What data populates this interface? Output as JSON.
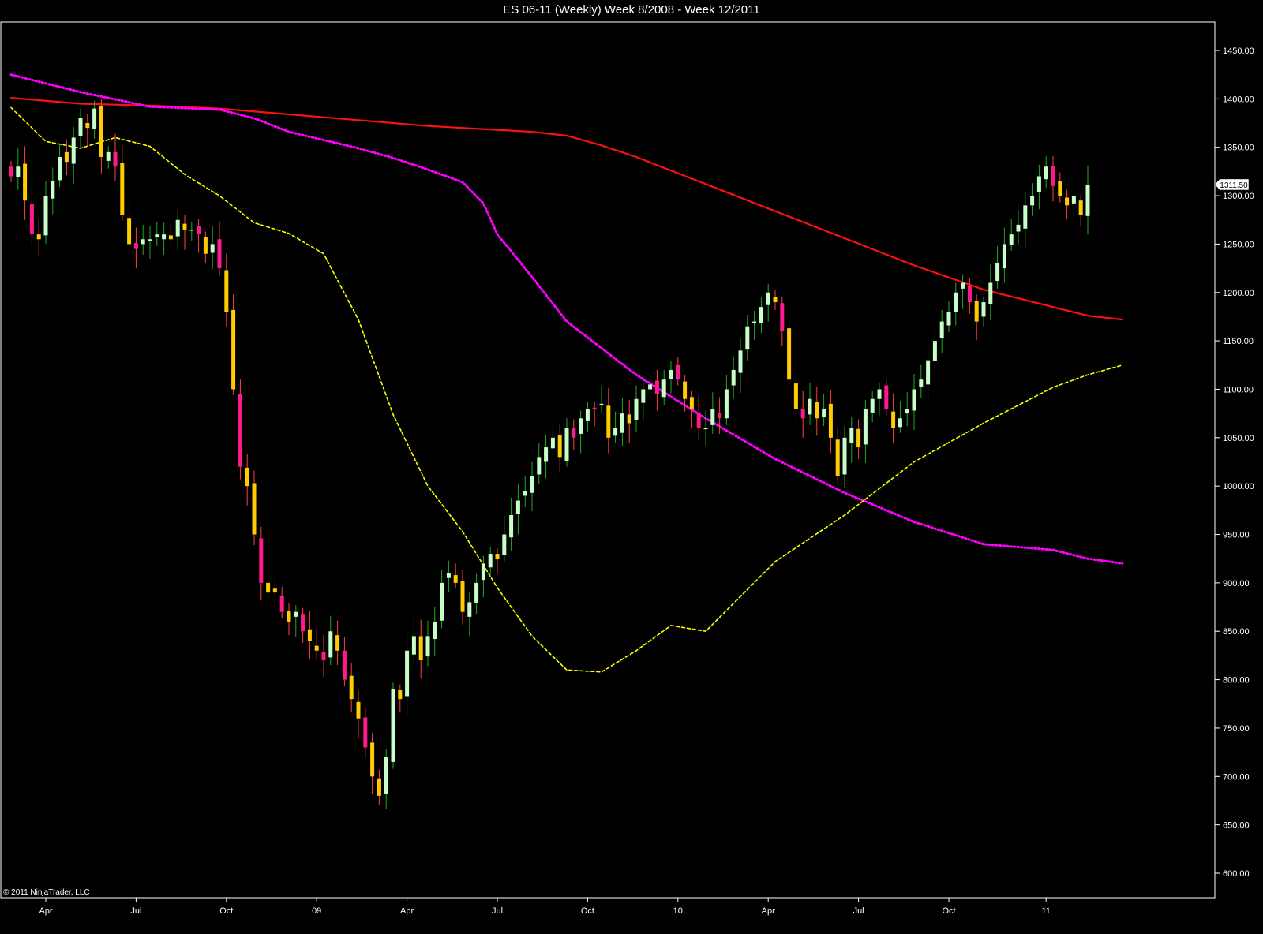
{
  "title": "ES 06-11 (Weekly)  Week 8/2008 - Week 12/2011",
  "copyright": "© 2011 NinjaTrader, LLC",
  "colors": {
    "background": "#000000",
    "up_candle": "#c8ffc8",
    "up_wick": "#22aa22",
    "down_candle": "#ffcc00",
    "down_pink": "#ff1a8c",
    "sma_fast": "#ffff00",
    "sma_mid": "#ff00ff",
    "sma_slow": "#ff1010",
    "axis": "#ffffff"
  },
  "chart_data": {
    "type": "candlestick",
    "title": "ES 06-11 (Weekly)  Week 8/2008 - Week 12/2011",
    "ylim": [
      590,
      1475
    ],
    "y_ticks": [
      "600.00",
      "650.00",
      "700.00",
      "750.00",
      "800.00",
      "850.00",
      "900.00",
      "950.00",
      "1000.00",
      "1050.00",
      "1100.00",
      "1150.00",
      "1200.00",
      "1250.00",
      "1300.00",
      "1350.00",
      "1400.00",
      "1450.00"
    ],
    "x_ticks": [
      {
        "label": "Apr",
        "week": 5
      },
      {
        "label": "Jul",
        "week": 18
      },
      {
        "label": "Oct",
        "week": 31
      },
      {
        "label": "09",
        "week": 44
      },
      {
        "label": "Apr",
        "week": 57
      },
      {
        "label": "Jul",
        "week": 70
      },
      {
        "label": "Oct",
        "week": 83
      },
      {
        "label": "10",
        "week": 96
      },
      {
        "label": "Apr",
        "week": 109
      },
      {
        "label": "Jul",
        "week": 122
      },
      {
        "label": "Oct",
        "week": 135
      },
      {
        "label": "11",
        "week": 149
      }
    ],
    "last_price": "1311.50",
    "grid": false,
    "closes": [
      1320,
      1330,
      1295,
      1260,
      1255,
      1300,
      1315,
      1340,
      1335,
      1360,
      1380,
      1370,
      1390,
      1340,
      1345,
      1330,
      1280,
      1250,
      1245,
      1255,
      1255,
      1260,
      1260,
      1255,
      1275,
      1265,
      1265,
      1260,
      1240,
      1250,
      1225,
      1180,
      1100,
      1020,
      1000,
      950,
      900,
      890,
      890,
      870,
      860,
      870,
      850,
      840,
      830,
      820,
      850,
      830,
      800,
      780,
      760,
      730,
      700,
      680,
      720,
      790,
      780,
      830,
      845,
      820,
      845,
      860,
      900,
      910,
      900,
      870,
      880,
      900,
      920,
      930,
      925,
      950,
      970,
      985,
      995,
      1010,
      1030,
      1040,
      1050,
      1030,
      1060,
      1050,
      1070,
      1080,
      1080,
      1085,
      1050,
      1060,
      1075,
      1065,
      1090,
      1100,
      1105,
      1095,
      1110,
      1120,
      1110,
      1090,
      1080,
      1060,
      1060,
      1080,
      1070,
      1100,
      1120,
      1140,
      1165,
      1170,
      1185,
      1200,
      1190,
      1160,
      1110,
      1080,
      1070,
      1090,
      1070,
      1080,
      1050,
      1010,
      1050,
      1060,
      1040,
      1080,
      1090,
      1100,
      1080,
      1060,
      1070,
      1080,
      1100,
      1110,
      1130,
      1150,
      1170,
      1180,
      1200,
      1210,
      1190,
      1170,
      1190,
      1210,
      1230,
      1250,
      1260,
      1270,
      1290,
      1300,
      1320,
      1330,
      1310,
      1300,
      1290,
      1300,
      1280,
      1311.5
    ],
    "series": [
      {
        "name": "",
        "style": "solid",
        "values": [
          [
            0,
            1401
          ],
          [
            10,
            1395
          ],
          [
            20,
            1393
          ],
          [
            30,
            1390
          ],
          [
            40,
            1384
          ],
          [
            50,
            1378
          ],
          [
            60,
            1372
          ],
          [
            65,
            1370
          ],
          [
            70,
            1368
          ],
          [
            75,
            1366
          ],
          [
            80,
            1362
          ],
          [
            85,
            1352
          ],
          [
            90,
            1340
          ],
          [
            95,
            1326
          ],
          [
            100,
            1312
          ],
          [
            110,
            1284
          ],
          [
            120,
            1256
          ],
          [
            130,
            1228
          ],
          [
            140,
            1203
          ],
          [
            145,
            1194
          ],
          [
            150,
            1185
          ],
          [
            155,
            1176
          ],
          [
            160,
            1172
          ]
        ]
      },
      {
        "name": "",
        "style": "dotted",
        "values": [
          [
            0,
            1425
          ],
          [
            10,
            1407
          ],
          [
            20,
            1392
          ],
          [
            30,
            1389
          ],
          [
            35,
            1380
          ],
          [
            40,
            1366
          ],
          [
            50,
            1349
          ],
          [
            55,
            1339
          ],
          [
            60,
            1327
          ],
          [
            65,
            1314
          ],
          [
            68,
            1292
          ],
          [
            70,
            1260
          ],
          [
            75,
            1216
          ],
          [
            80,
            1170
          ],
          [
            90,
            1115
          ],
          [
            100,
            1070
          ],
          [
            110,
            1028
          ],
          [
            120,
            993
          ],
          [
            130,
            963
          ],
          [
            140,
            940
          ],
          [
            145,
            937
          ],
          [
            150,
            934
          ],
          [
            155,
            925
          ],
          [
            160,
            920
          ]
        ]
      },
      {
        "name": "",
        "style": "dashed",
        "values": [
          [
            0,
            1391
          ],
          [
            5,
            1356
          ],
          [
            10,
            1349
          ],
          [
            15,
            1360
          ],
          [
            20,
            1351
          ],
          [
            25,
            1322
          ],
          [
            30,
            1300
          ],
          [
            35,
            1272
          ],
          [
            40,
            1261
          ],
          [
            45,
            1240
          ],
          [
            50,
            1172
          ],
          [
            55,
            1074
          ],
          [
            60,
            1000
          ],
          [
            65,
            953
          ],
          [
            70,
            895
          ],
          [
            75,
            845
          ],
          [
            80,
            810
          ],
          [
            85,
            808
          ],
          [
            90,
            830
          ],
          [
            95,
            856
          ],
          [
            100,
            850
          ],
          [
            110,
            922
          ],
          [
            120,
            970
          ],
          [
            130,
            1025
          ],
          [
            140,
            1065
          ],
          [
            150,
            1102
          ],
          [
            155,
            1115
          ],
          [
            160,
            1125
          ]
        ]
      }
    ]
  }
}
